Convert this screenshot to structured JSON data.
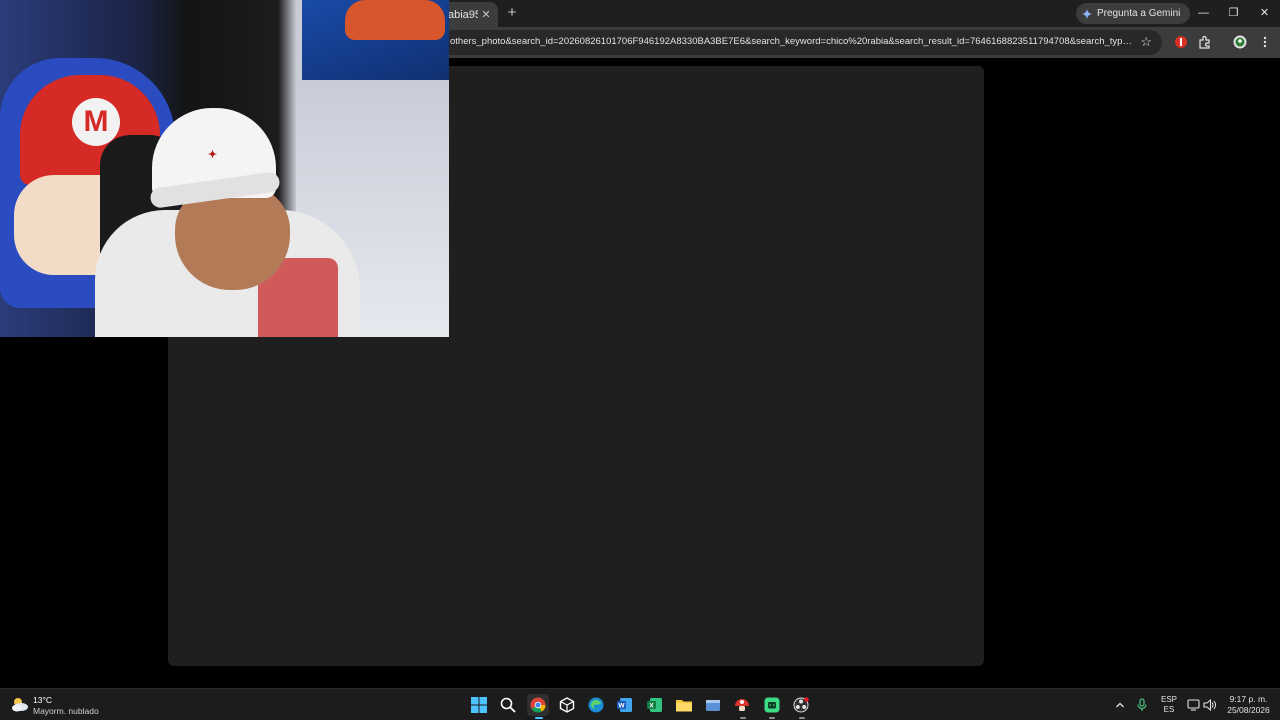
{
  "browser": {
    "tab_title": "abia95)",
    "tab_close": "✕",
    "new_tab": "+",
    "gemini_label": "Pregunta a Gemini",
    "window_controls": {
      "minimize": "—",
      "restore": "❐",
      "close": "✕"
    },
    "url": "others_photo&search_id=20260826101706F946192A8330BA3BE7E6&search_keyword=chico%20rabia&search_result_id=7646168823511794708&search_type=gene...",
    "bookmark_star": "☆"
  },
  "taskbar": {
    "weather": {
      "temp": "13°C",
      "desc": "Mayorm. nublado"
    },
    "apps": [
      {
        "name": "start-button",
        "icon": "windows-icon"
      },
      {
        "name": "search-button",
        "icon": "search-icon"
      },
      {
        "name": "chrome",
        "icon": "chrome-icon"
      },
      {
        "name": "vpn-app",
        "icon": "cube-icon"
      },
      {
        "name": "edge",
        "icon": "edge-icon"
      },
      {
        "name": "word",
        "icon": "word-icon"
      },
      {
        "name": "excel",
        "icon": "excel-icon"
      },
      {
        "name": "file-explorer",
        "icon": "folder-icon"
      },
      {
        "name": "app-window",
        "icon": "window-icon"
      },
      {
        "name": "game-app",
        "icon": "mushroom-icon"
      },
      {
        "name": "android-app",
        "icon": "android-icon"
      },
      {
        "name": "obs",
        "icon": "obs-icon"
      }
    ],
    "lang_top": "ESP",
    "lang_bottom": "ES",
    "clock_time": "9:17 p. m.",
    "clock_date": "25/08/2026"
  },
  "colors": {
    "chrome_dark": "#1f1f1f",
    "toolbar": "#3c3c3c",
    "page_bg": "#000000",
    "panel": "#1f1f1f",
    "taskbar": "#1c1c1c"
  }
}
